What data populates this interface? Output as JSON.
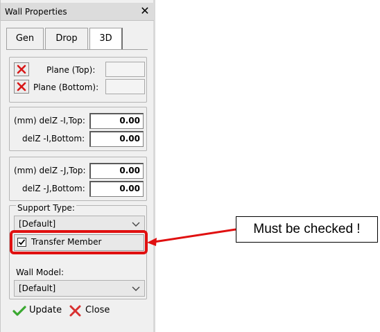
{
  "window": {
    "title": "Wall Properties",
    "close_glyph": "✕"
  },
  "tabs": [
    {
      "label": "Gen"
    },
    {
      "label": "Drop"
    },
    {
      "label": "3D",
      "active": true
    }
  ],
  "planes": {
    "top_label": "Plane (Top):",
    "bottom_label": "Plane (Bottom):",
    "button_icon": "red-x-icon"
  },
  "i_group": {
    "top_label": "(mm) delZ -I,Top:",
    "top_value": "0.00",
    "bottom_label": "delZ -I,Bottom:",
    "bottom_value": "0.00"
  },
  "j_group": {
    "top_label": "(mm) delZ -J,Top:",
    "top_value": "0.00",
    "bottom_label": "delZ -J,Bottom:",
    "bottom_value": "0.00"
  },
  "support_type": {
    "label": "Support Type:",
    "value": "[Default]"
  },
  "transfer_member": {
    "label": "Transfer Member",
    "checked": true
  },
  "wall_model": {
    "label": "Wall Model:",
    "value": "[Default]"
  },
  "actions": {
    "update_label": "Update",
    "close_label": "Close"
  },
  "annotation": {
    "text": "Must be checked !",
    "color": "#e01010"
  }
}
